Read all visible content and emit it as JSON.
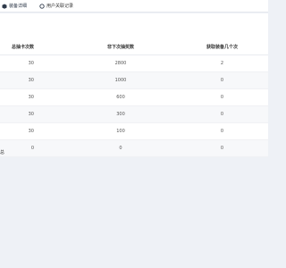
{
  "tabs": [
    {
      "label": "装备详细",
      "icon": "cube-icon"
    },
    {
      "label": "用户关联记录",
      "icon": "circle-icon"
    }
  ],
  "table": {
    "headers": [
      "总抽卡次数",
      "非下次抽奖数",
      "获取装备几个次"
    ],
    "rows": [
      [
        "30",
        "2800",
        "2"
      ],
      [
        "30",
        "1000",
        "0"
      ],
      [
        "30",
        "600",
        "0"
      ],
      [
        "30",
        "300",
        "0"
      ],
      [
        "30",
        "100",
        "0"
      ],
      [
        "0",
        "0",
        "0"
      ]
    ]
  },
  "footer": {
    "note": "总"
  }
}
